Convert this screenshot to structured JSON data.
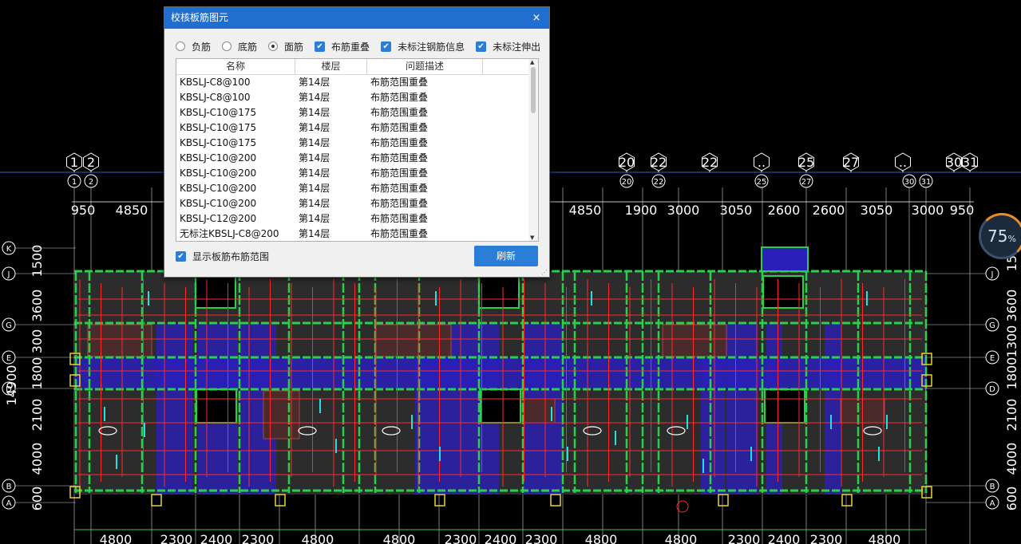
{
  "dialog": {
    "title": "校核板筋图元",
    "close_glyph": "×",
    "radios": [
      {
        "label": "负筋",
        "selected": false
      },
      {
        "label": "底筋",
        "selected": false
      },
      {
        "label": "面筋",
        "selected": true
      }
    ],
    "checks": [
      {
        "label": "布筋重叠",
        "checked": true
      },
      {
        "label": "未标注钢筋信息",
        "checked": true
      },
      {
        "label": "未标注伸出长度",
        "checked": true
      }
    ],
    "columns": [
      "名称",
      "楼层",
      "问题描述"
    ],
    "rows": [
      {
        "name": "KBSLJ-C8@100",
        "floor": "第14层",
        "issue": "布筋范围重叠"
      },
      {
        "name": "KBSLJ-C8@100",
        "floor": "第14层",
        "issue": "布筋范围重叠"
      },
      {
        "name": "KBSLJ-C10@175",
        "floor": "第14层",
        "issue": "布筋范围重叠"
      },
      {
        "name": "KBSLJ-C10@175",
        "floor": "第14层",
        "issue": "布筋范围重叠"
      },
      {
        "name": "KBSLJ-C10@175",
        "floor": "第14层",
        "issue": "布筋范围重叠"
      },
      {
        "name": "KBSLJ-C10@200",
        "floor": "第14层",
        "issue": "布筋范围重叠"
      },
      {
        "name": "KBSLJ-C10@200",
        "floor": "第14层",
        "issue": "布筋范围重叠"
      },
      {
        "name": "KBSLJ-C10@200",
        "floor": "第14层",
        "issue": "布筋范围重叠"
      },
      {
        "name": "KBSLJ-C10@200",
        "floor": "第14层",
        "issue": "布筋范围重叠"
      },
      {
        "name": "KBSLJ-C12@200",
        "floor": "第14层",
        "issue": "布筋范围重叠"
      },
      {
        "name": "无标注KBSLJ-C8@200",
        "floor": "第14层",
        "issue": "布筋范围重叠"
      }
    ],
    "show_range_label": "显示板筋布筋范围",
    "show_range_checked": true,
    "refresh_label": "刷新"
  },
  "zoom": {
    "value": "75",
    "unit": "%"
  },
  "drawing": {
    "top_axes": [
      "1",
      "2",
      "20",
      "22",
      "22",
      "..",
      "25",
      "27",
      "..",
      "30",
      "31"
    ],
    "top_axes_small": [
      "1",
      "2",
      "20",
      "22",
      "25",
      "27",
      "30",
      "31"
    ],
    "top_dims": [
      "950",
      "4850",
      "4850",
      "1900",
      "3000",
      "3050",
      "2600",
      "2600",
      "3050",
      "3000",
      "950"
    ],
    "left_axes": [
      "K",
      "J",
      "G",
      "E",
      "D",
      "B",
      "A"
    ],
    "right_axes": [
      "J",
      "G",
      "E",
      "D",
      "B",
      "A"
    ],
    "left_dims": [
      "1500",
      "3600",
      "300",
      "1800",
      "2100",
      "4000",
      "600",
      "14900"
    ],
    "right_dims": [
      "15",
      "3600",
      "1300",
      "1800",
      "2100",
      "4000",
      "600"
    ],
    "bottom_dims": [
      "4800",
      "2300",
      "2400",
      "2300",
      "4800",
      "4800",
      "2300",
      "2400",
      "2300",
      "4800",
      "4800",
      "2300",
      "2400",
      "2300",
      "4800"
    ],
    "colors": {
      "background": "#000000",
      "axis": "#ffffff",
      "wall": "#29d14a",
      "rebar": "#ff2a2a",
      "slab": "#2c2c2c",
      "overlap": "#2a1fb8",
      "hatch": "#6a3a3a",
      "text_cyan": "#26e0e0"
    }
  }
}
